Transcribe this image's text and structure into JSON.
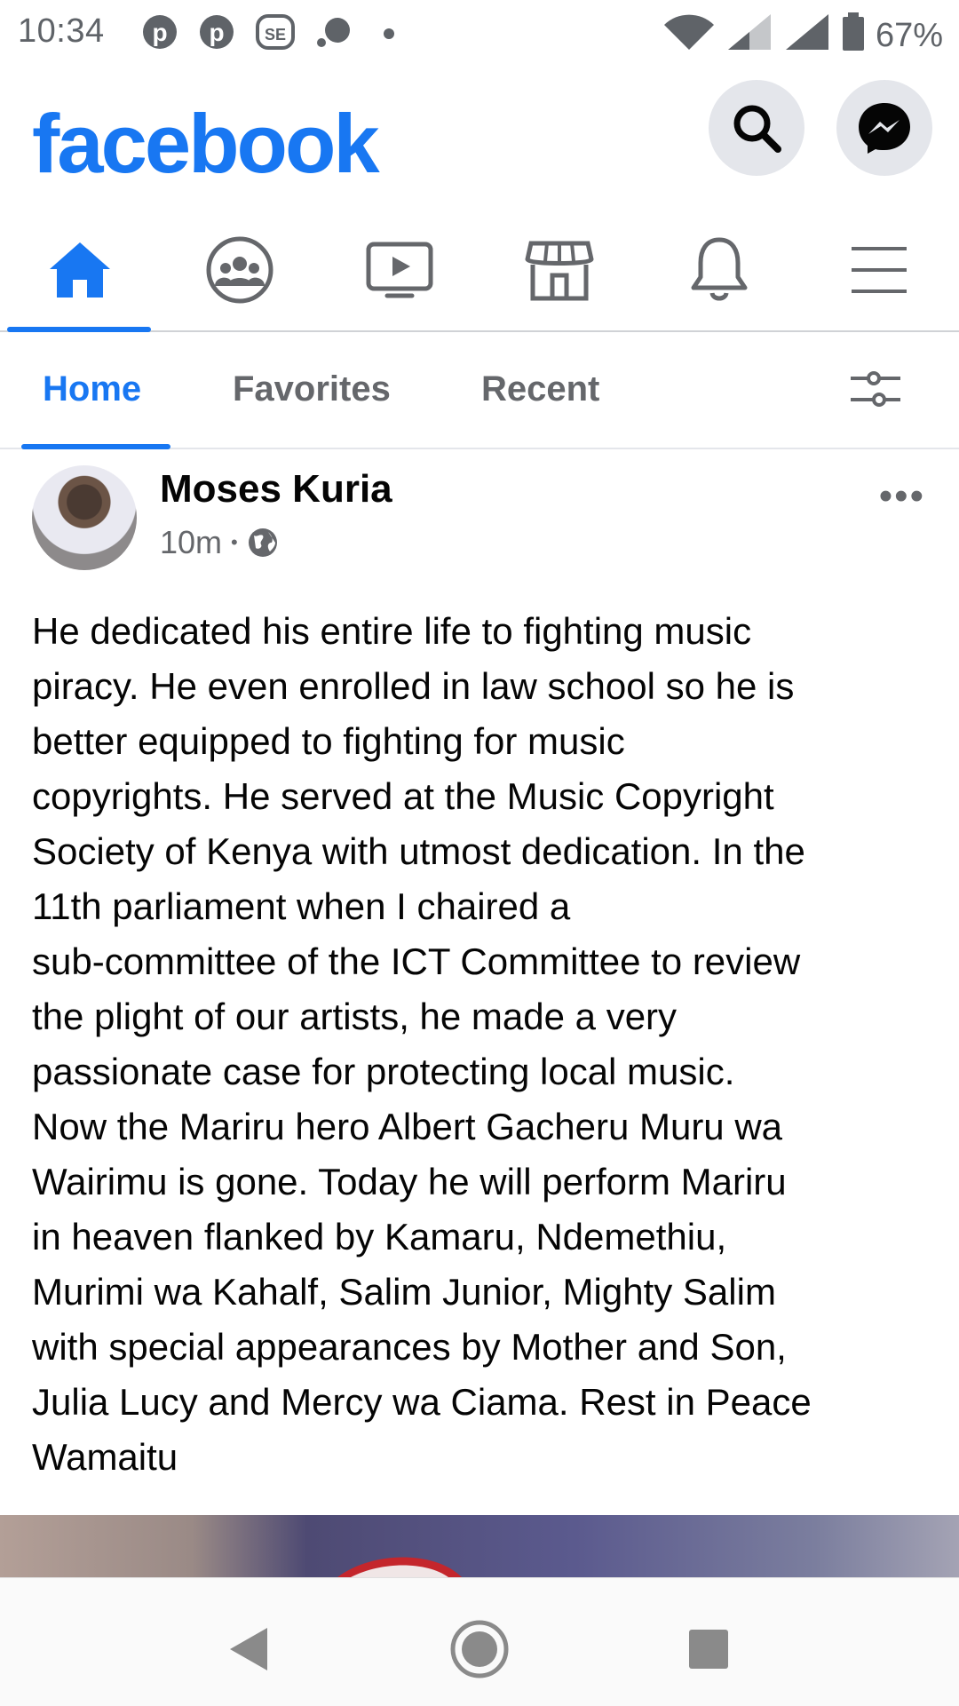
{
  "status_bar": {
    "time": "10:34",
    "battery": "67%",
    "notification_icons": [
      "pinterest-icon",
      "pinterest-icon",
      "sportpesa-icon",
      "chat-bubble-icon"
    ]
  },
  "header": {
    "logo": "facebook",
    "brand_color": "#1877f2",
    "icons": [
      "search-icon",
      "messenger-icon"
    ]
  },
  "nav": {
    "items": [
      "home",
      "groups",
      "watch",
      "marketplace",
      "notifications",
      "menu"
    ],
    "active": "home"
  },
  "feed_tabs": {
    "items": [
      "Home",
      "Favorites",
      "Recent"
    ],
    "active": "Home"
  },
  "post": {
    "author": "Moses Kuria",
    "time": "10m",
    "separator": "•",
    "more": "•••",
    "text_lines": [
      "He dedicated his entire life to fighting music",
      "piracy. He even enrolled in law school so he is",
      "better equipped to fighting for music",
      "copyrights. He served at the Music Copyright",
      "Society of Kenya with utmost dedication. In the",
      "11th parliament when I chaired a",
      "sub-committee of the ICT Committee to review",
      "the plight of our artists, he made a very",
      "passionate case for protecting local music.",
      "Now the Mariru hero Albert Gacheru Muru wa",
      "Wairimu is gone. Today he will perform Mariru",
      "in heaven flanked by Kamaru, Ndemethiu,",
      "Murimi wa Kahalf, Salim Junior, Mighty Salim",
      "with special appearances by Mother and Son,",
      "Julia Lucy and Mercy wa Ciama. Rest in Peace",
      "Wamaitu"
    ]
  }
}
